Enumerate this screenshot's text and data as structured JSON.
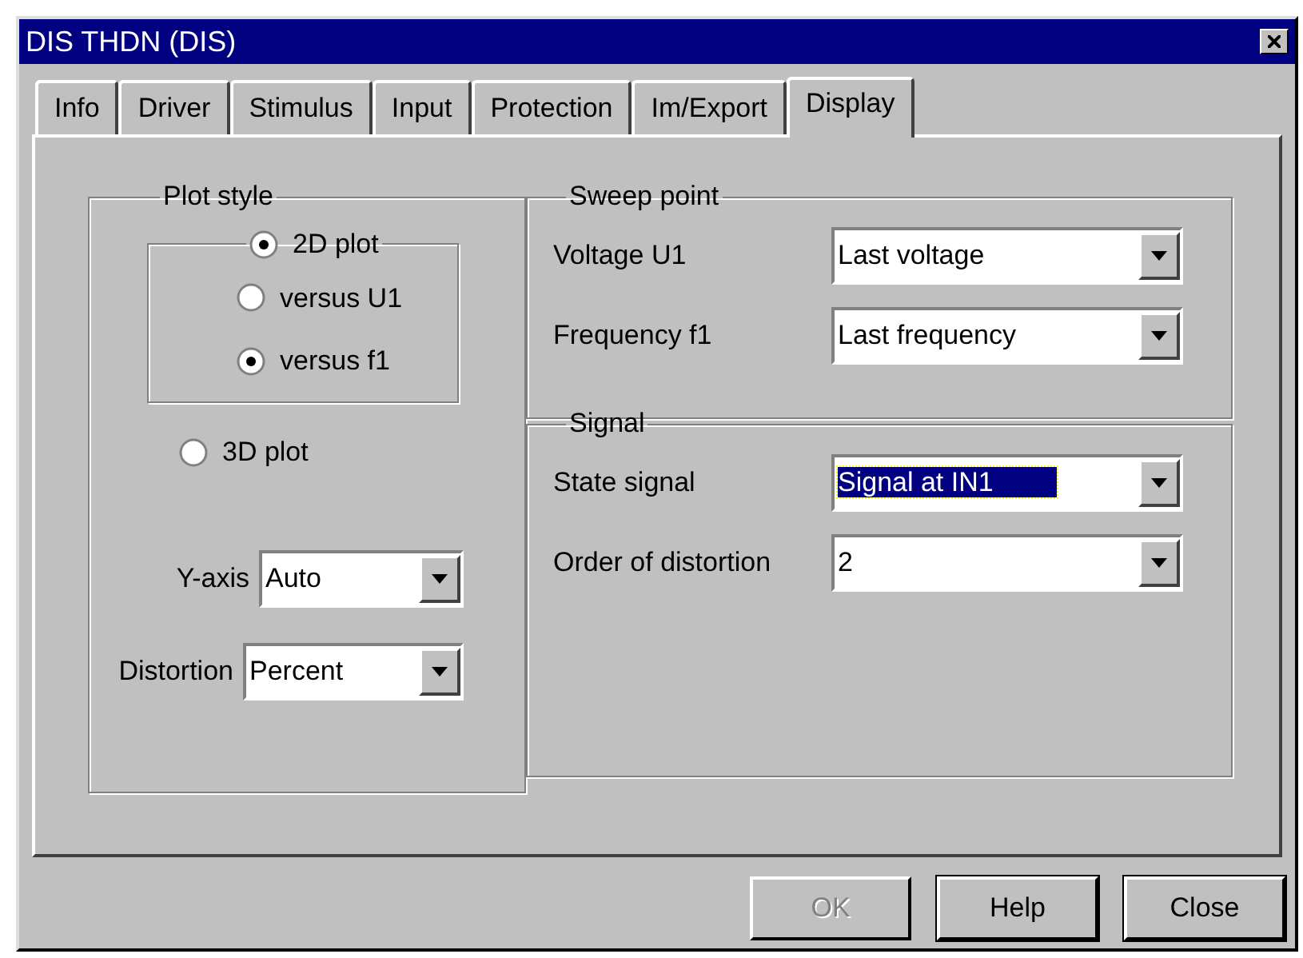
{
  "window": {
    "title": "DIS THDN (DIS)"
  },
  "tabs": [
    {
      "label": "Info",
      "selected": false
    },
    {
      "label": "Driver",
      "selected": false
    },
    {
      "label": "Stimulus",
      "selected": false
    },
    {
      "label": "Input",
      "selected": false
    },
    {
      "label": "Protection",
      "selected": false
    },
    {
      "label": "Im/Export",
      "selected": false
    },
    {
      "label": "Display",
      "selected": true
    }
  ],
  "plot_style": {
    "title": "Plot style",
    "options": [
      {
        "label": "2D plot",
        "selected": true,
        "children": [
          {
            "label": "versus U1",
            "selected": false
          },
          {
            "label": "versus f1",
            "selected": true
          }
        ]
      },
      {
        "label": "3D plot",
        "selected": false
      }
    ],
    "fields": [
      {
        "label": "Y-axis",
        "value": "Auto"
      },
      {
        "label": "Distortion",
        "value": "Percent"
      }
    ]
  },
  "sweep_point": {
    "title": "Sweep point",
    "fields": [
      {
        "label": "Voltage U1",
        "value": "Last voltage",
        "focused": false
      },
      {
        "label": "Frequency f1",
        "value": "Last frequency",
        "focused": false
      }
    ]
  },
  "signal": {
    "title": "Signal",
    "fields": [
      {
        "label": "State signal",
        "value": "Signal at IN1",
        "focused": true
      },
      {
        "label": "Order of distortion",
        "value": "2",
        "focused": false
      }
    ]
  },
  "buttons": [
    {
      "label": "OK",
      "disabled": true
    },
    {
      "label": "Help",
      "disabled": false
    },
    {
      "label": "Close",
      "disabled": false
    }
  ]
}
